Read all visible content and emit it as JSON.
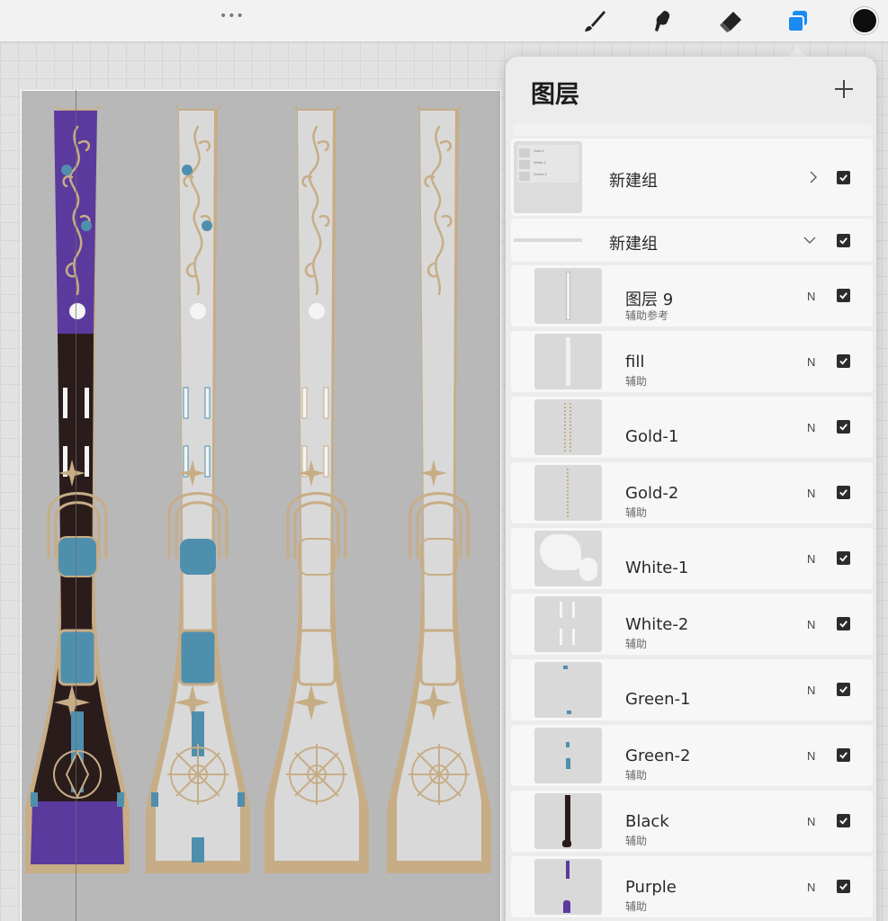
{
  "toolbar": {
    "more_icon": "more-icon",
    "tools": [
      "brush-icon",
      "smudge-icon",
      "eraser-icon",
      "layers-icon"
    ],
    "active_tool": "layers-icon",
    "current_color": "#0e0e0e",
    "accent": "#1a8bf0"
  },
  "layers_panel": {
    "title": "图层",
    "groups": [
      {
        "name": "新建组",
        "expanded": false,
        "visible": true,
        "thumb_lines": [
          "Gold-2",
          "White-2",
          "Green-2"
        ]
      },
      {
        "name": "新建组",
        "expanded": true,
        "visible": true
      }
    ],
    "layers": [
      {
        "name": "图层 9",
        "sub": "辅助参考",
        "blend": "N",
        "visible": true
      },
      {
        "name": "fill",
        "sub": "辅助",
        "blend": "N",
        "visible": true
      },
      {
        "name": "Gold-1",
        "sub": "",
        "blend": "N",
        "visible": true
      },
      {
        "name": "Gold-2",
        "sub": "辅助",
        "blend": "N",
        "visible": true
      },
      {
        "name": "White-1",
        "sub": "",
        "blend": "N",
        "visible": true
      },
      {
        "name": "White-2",
        "sub": "辅助",
        "blend": "N",
        "visible": true
      },
      {
        "name": "Green-1",
        "sub": "",
        "blend": "N",
        "visible": true
      },
      {
        "name": "Green-2",
        "sub": "辅助",
        "blend": "N",
        "visible": true
      },
      {
        "name": "Black",
        "sub": "辅助",
        "blend": "N",
        "visible": true
      },
      {
        "name": "Purple",
        "sub": "辅助",
        "blend": "N",
        "visible": true
      }
    ]
  },
  "artwork": {
    "colors": {
      "gold": "#c7ad86",
      "purple": "#5b3a9e",
      "dark": "#2b1c1c",
      "teal": "#4f8fae",
      "white": "#f4f4f4",
      "base": "#b8b8b8"
    }
  }
}
